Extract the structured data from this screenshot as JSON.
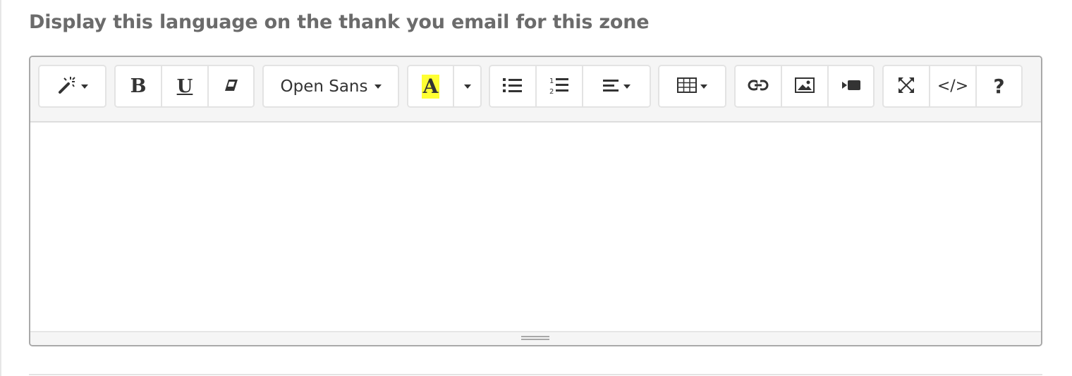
{
  "label": "Display this language on the thank you email for this zone",
  "toolbar": {
    "font_family": "Open Sans",
    "color_glyph": "A",
    "bold_glyph": "B",
    "underline_glyph": "U",
    "code_glyph": "</>",
    "help_glyph": "?",
    "highlight_color": "#ffff33",
    "icons": [
      "magic-style-icon",
      "bold-icon",
      "underline-icon",
      "eraser-icon",
      "font-color-icon",
      "unordered-list-icon",
      "ordered-list-icon",
      "align-icon",
      "table-icon",
      "link-icon",
      "picture-icon",
      "video-icon",
      "fullscreen-icon",
      "code-view-icon",
      "help-icon"
    ]
  },
  "editor": {
    "content": ""
  }
}
